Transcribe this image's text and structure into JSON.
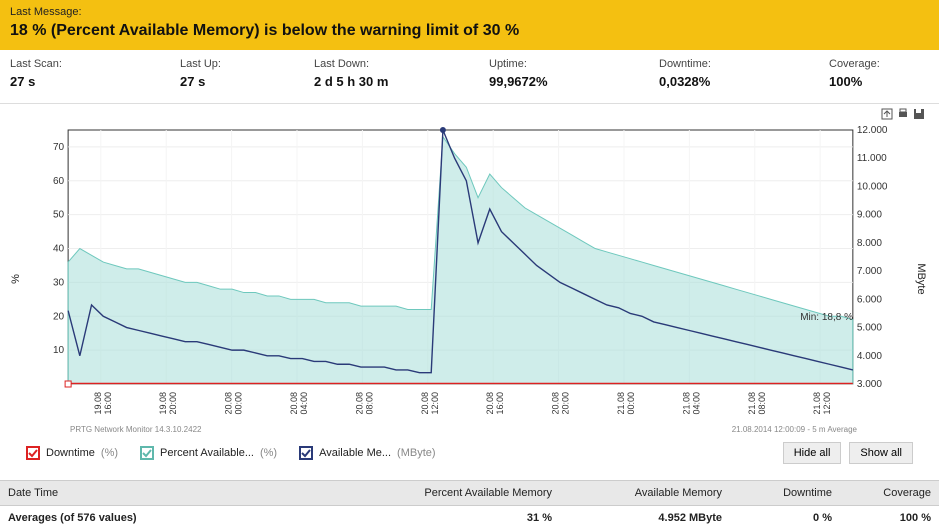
{
  "warning": {
    "label": "Last Message:",
    "message": "18 % (Percent Available Memory) is below the warning limit of 30 %"
  },
  "stats": {
    "last_scan": {
      "label": "Last Scan:",
      "value": "27 s"
    },
    "last_up": {
      "label": "Last Up:",
      "value": "27 s"
    },
    "last_down": {
      "label": "Last Down:",
      "value": "2 d 5 h 30 m"
    },
    "uptime": {
      "label": "Uptime:",
      "value": "99,9672%"
    },
    "downtime": {
      "label": "Downtime:",
      "value": "0,0328%"
    },
    "coverage": {
      "label": "Coverage:",
      "value": "100%"
    }
  },
  "chart_data": {
    "type": "line",
    "x_labels": [
      "19.08 16:00",
      "19.08 20:00",
      "20.08 00:00",
      "20.08 04:00",
      "20.08 08:00",
      "20.08 12:00",
      "20.08 16:00",
      "20.08 20:00",
      "21.08 00:00",
      "21.08 04:00",
      "21.08 08:00",
      "21.08 12:00"
    ],
    "y_left_label": "%",
    "y_right_label": "MByte",
    "ylim_left": [
      0,
      75
    ],
    "ylim_right": [
      3.0,
      12.0
    ],
    "y_left_ticks": [
      10,
      20,
      30,
      40,
      50,
      60,
      70
    ],
    "y_right_ticks": [
      3.0,
      4.0,
      5.0,
      6.0,
      7.0,
      8.0,
      9.0,
      10.0,
      11.0,
      12.0
    ],
    "series": [
      {
        "name": "Percent Available Memory",
        "axis": "left",
        "style": "area",
        "color": "#a8dfd9",
        "stroke": "#6ec8bd",
        "values": [
          36,
          40,
          38,
          36,
          35,
          34,
          34,
          33,
          32,
          31,
          30,
          30,
          29,
          28,
          28,
          27,
          27,
          26,
          26,
          25,
          25,
          25,
          24,
          24,
          24,
          23,
          23,
          23,
          23,
          22,
          22,
          22,
          73,
          68,
          64,
          55,
          62,
          58,
          55,
          52,
          50,
          48,
          46,
          44,
          42,
          40,
          39,
          38,
          37,
          36,
          35,
          34,
          33,
          32,
          31,
          30,
          29,
          28,
          27,
          26,
          25,
          24,
          23,
          22,
          21,
          20,
          20,
          19
        ]
      },
      {
        "name": "Available Memory",
        "axis": "right",
        "style": "line",
        "color": "#2a3a78",
        "values": [
          5.6,
          4.0,
          5.8,
          5.4,
          5.2,
          5.0,
          4.9,
          4.8,
          4.7,
          4.6,
          4.5,
          4.5,
          4.4,
          4.3,
          4.2,
          4.2,
          4.1,
          4.0,
          4.0,
          3.9,
          3.9,
          3.8,
          3.8,
          3.7,
          3.7,
          3.6,
          3.6,
          3.6,
          3.5,
          3.5,
          3.4,
          3.4,
          12.0,
          11.0,
          10.2,
          8.0,
          9.2,
          8.4,
          8.0,
          7.6,
          7.2,
          6.9,
          6.6,
          6.4,
          6.2,
          6.0,
          5.8,
          5.7,
          5.5,
          5.4,
          5.2,
          5.1,
          5.0,
          4.9,
          4.8,
          4.7,
          4.6,
          4.5,
          4.4,
          4.3,
          4.2,
          4.1,
          4.0,
          3.9,
          3.8,
          3.7,
          3.6,
          3.5
        ]
      },
      {
        "name": "Downtime",
        "axis": "left",
        "style": "baseline",
        "color": "#d22",
        "values": []
      }
    ],
    "annotation": "Min: 18,8 %",
    "footer_left": "PRTG Network Monitor 14.3.10.2422",
    "footer_right": "21.08.2014 12:00:09 - 5 m Average"
  },
  "legend": {
    "downtime": {
      "label": "Downtime",
      "unit": "(%)",
      "color": "#d22"
    },
    "pam": {
      "label": "Percent Available...",
      "unit": "(%)",
      "color": "#5fb8ac"
    },
    "am": {
      "label": "Available Me...",
      "unit": "(MByte)",
      "color": "#2a3a78"
    },
    "hide_all": "Hide all",
    "show_all": "Show all"
  },
  "table": {
    "headers": {
      "dt": "Date Time",
      "pam": "Percent Available Memory",
      "am": "Available Memory",
      "dn": "Downtime",
      "cov": "Coverage"
    },
    "row": {
      "dt": "Averages (of 576 values)",
      "pam": "31 %",
      "am": "4.952 MByte",
      "dn": "0 %",
      "cov": "100 %"
    }
  },
  "icons": {
    "export": "export-icon",
    "print": "print-icon",
    "save": "save-icon"
  }
}
